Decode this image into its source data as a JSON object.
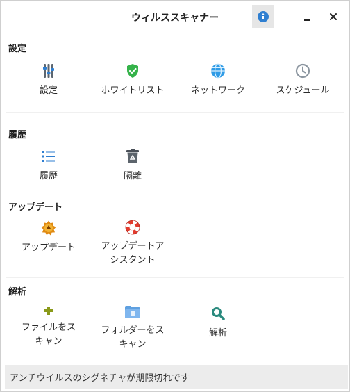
{
  "window": {
    "title": "ウィルススキャナー",
    "buttons": {
      "info": "info-icon",
      "minimize": "minimize-icon",
      "close": "close-icon"
    }
  },
  "sections": {
    "settings": {
      "title": "設定",
      "items": [
        {
          "label": "設定",
          "icon": "sliders-icon"
        },
        {
          "label": "ホワイトリスト",
          "icon": "shield-check-icon"
        },
        {
          "label": "ネットワーク",
          "icon": "globe-icon"
        },
        {
          "label": "スケジュール",
          "icon": "clock-icon"
        }
      ]
    },
    "history": {
      "title": "履歴",
      "items": [
        {
          "label": "履歴",
          "icon": "list-icon"
        },
        {
          "label": "隔離",
          "icon": "recycle-bin-icon"
        }
      ]
    },
    "update": {
      "title": "アップデート",
      "items": [
        {
          "label": "アップデート",
          "icon": "update-badge-icon"
        },
        {
          "label": "アップデートア\nシスタント",
          "icon": "lifebuoy-icon"
        }
      ]
    },
    "scan": {
      "title": "解析",
      "items": [
        {
          "label": "ファイルをス\nキャン",
          "icon": "plus-icon"
        },
        {
          "label": "フォルダーをス\nキャン",
          "icon": "folder-icon"
        },
        {
          "label": "解析",
          "icon": "magnifier-icon"
        }
      ]
    }
  },
  "status": {
    "text": "アンチウイルスのシグネチャが期限切れです"
  },
  "colors": {
    "accent_blue": "#2f7fd1",
    "green": "#35b34a",
    "olive": "#8a9a1a",
    "gray_icon": "#8c96a0",
    "status_bg": "#ececec"
  }
}
